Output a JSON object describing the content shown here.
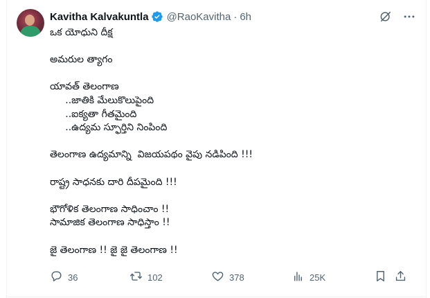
{
  "author": {
    "name": "Kavitha Kalvakuntla",
    "handle": "@RaoKavitha",
    "separator": "·",
    "time": "6h"
  },
  "post": {
    "lines": [
      "ఒక యోధుని దీక్ష",
      "",
      "అమరుల త్యాగం",
      "",
      "యావత్ తెలంగాణ",
      "     ..జాతికి మేలుకొలుపైంది",
      "     ..ఐక్యతా గీతమైంది",
      "     ..ఉద్యమ స్ఫూర్తిని నింపింది",
      "",
      "తెలంగాణ ఉద్యమాన్ని  విజయపథం వైపు నడిపింది !!!",
      "",
      "రాష్ట్ర సాధనకు దారి దీపమైంది !!!",
      "",
      "భౌగోళిక తెలంగాణ సాధించాం !!",
      "సామాజిక తెలంగాణ సాధిస్తాం !!",
      "",
      "జై తెలంగాణ !! జై జై తెలంగాణ !!"
    ]
  },
  "actions": {
    "replies": "36",
    "reposts": "102",
    "likes": "378",
    "views": "25K"
  },
  "icons": {
    "verified": "verified-badge-icon",
    "grok": "grok-icon",
    "more": "more-icon",
    "reply": "reply-icon",
    "repost": "repost-icon",
    "like": "heart-icon",
    "views": "views-icon",
    "bookmark": "bookmark-icon",
    "share": "share-icon"
  },
  "colors": {
    "text": "#0f1419",
    "secondary": "#536471",
    "verified": "#1d9bf0"
  }
}
